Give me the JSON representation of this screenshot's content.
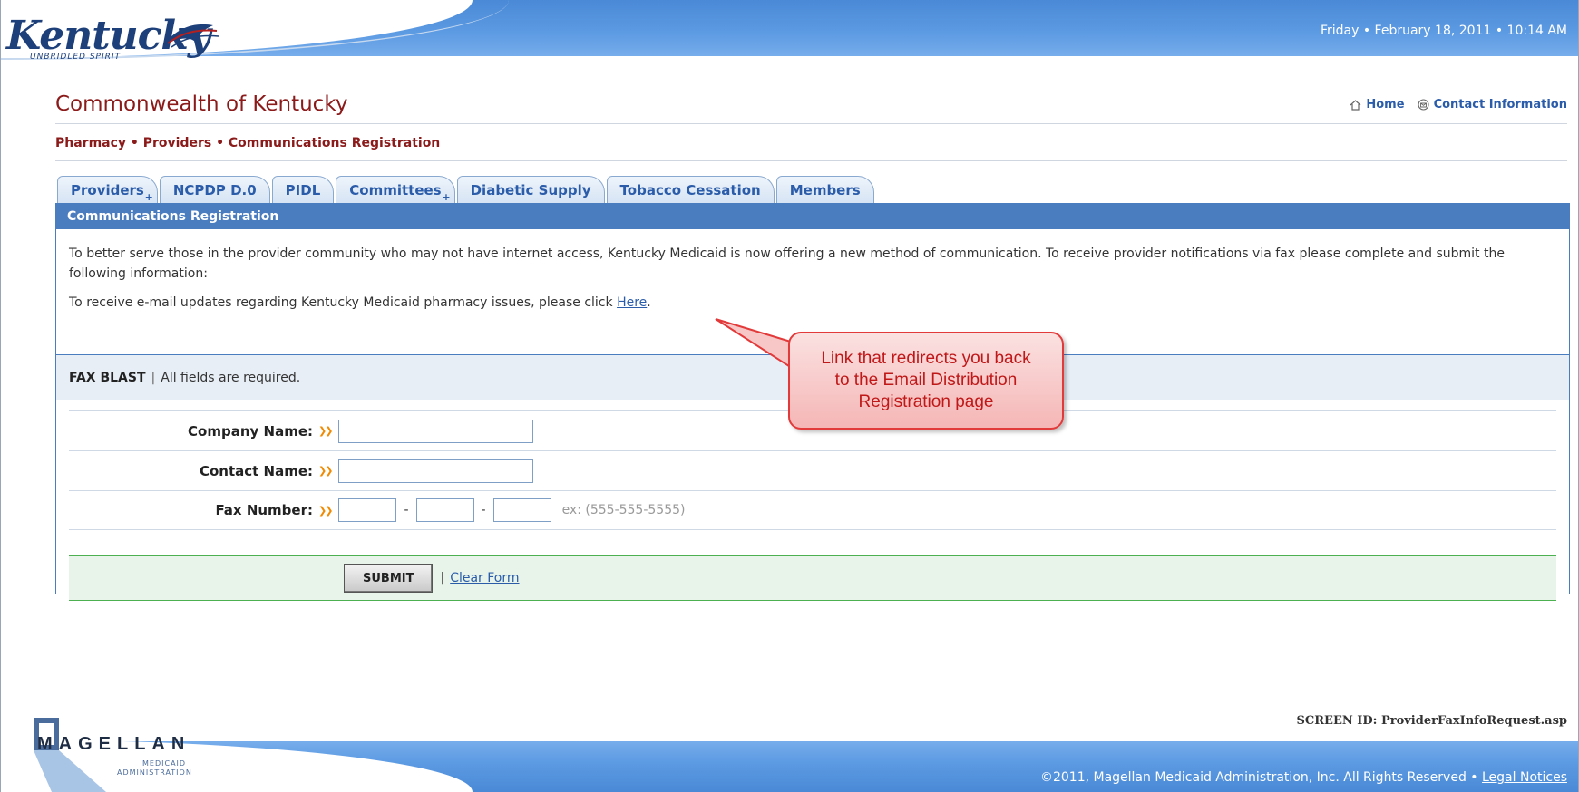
{
  "header": {
    "logo_word": "Kentucky",
    "logo_tagline": "UNBRIDLED SPIRIT",
    "datetime": "Friday • February 18, 2011 • 10:14 AM",
    "site_title": "Commonwealth of Kentucky",
    "links": [
      {
        "label": "Home",
        "icon": "home-icon"
      },
      {
        "label": "Contact Information",
        "icon": "envelope-icon"
      }
    ],
    "breadcrumb": "Pharmacy • Providers • Communications Registration"
  },
  "tabs": [
    {
      "label": "Providers",
      "has_plus": true
    },
    {
      "label": "NCPDP D.0",
      "has_plus": false
    },
    {
      "label": "PIDL",
      "has_plus": false
    },
    {
      "label": "Committees",
      "has_plus": true
    },
    {
      "label": "Diabetic Supply",
      "has_plus": false
    },
    {
      "label": "Tobacco Cessation",
      "has_plus": false
    },
    {
      "label": "Members",
      "has_plus": false
    }
  ],
  "panel": {
    "title": "Communications Registration",
    "intro_text": "To better serve those in the provider community who may not have internet access, Kentucky Medicaid is now offering a new method of communication. To receive provider notifications via fax please complete and submit the following information:",
    "email_text_before": "To receive e-mail updates regarding Kentucky Medicaid pharmacy issues, please click ",
    "email_link": "Here",
    "email_text_after": "."
  },
  "fax_form": {
    "heading": "FAX BLAST",
    "separator": "|",
    "subheading": "All fields are required.",
    "company_label": "Company Name:",
    "company_value": "",
    "contact_label": "Contact Name:",
    "contact_value": "",
    "fax_label": "Fax Number:",
    "fax_part1": "",
    "fax_part2": "",
    "fax_part3": "",
    "fax_dash": "-",
    "fax_example": "ex: (555-555-5555)",
    "submit_label": "SUBMIT",
    "separator2": "|",
    "clear_label": "Clear Form"
  },
  "callout": {
    "line1": "Link that redirects you back",
    "line2": "to the Email Distribution",
    "line3": "Registration page"
  },
  "footer": {
    "screen_id": "SCREEN ID: ProviderFaxInfoRequest.asp",
    "magellan_word": "MAGELLAN",
    "magellan_sub1": "MEDICAID",
    "magellan_sub2": "ADMINISTRATION",
    "copyright": "©2011, Magellan Medicaid Administration, Inc. All Rights Reserved • ",
    "legal_link": "Legal Notices"
  },
  "colors": {
    "brand_blue": "#4a7cc0",
    "title_red": "#8b1a1a",
    "link_blue": "#2a5caa",
    "callout_red": "#e23a3a",
    "submit_green": "#4caf50"
  }
}
